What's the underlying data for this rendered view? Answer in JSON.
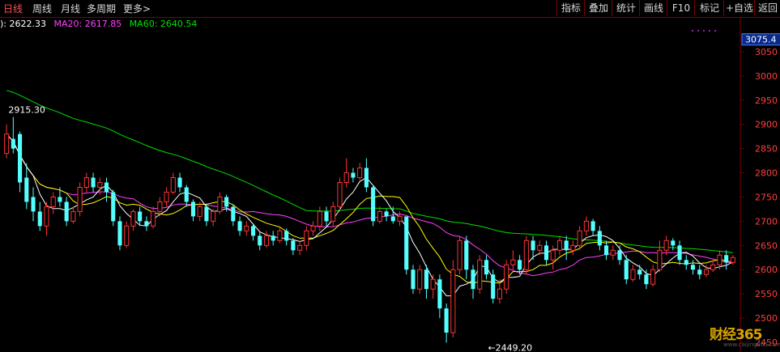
{
  "toolbar": {
    "left_tabs": [
      "日线",
      "周线",
      "月线",
      "多周期",
      "更多>"
    ],
    "right_buttons": [
      "指标",
      "叠加",
      "统计",
      "画线",
      "F10",
      "标记",
      "+自选",
      "返回"
    ]
  },
  "ma_legend": {
    "ma5": "): 2622.33",
    "ma20": "MA20: 2617.85",
    "ma60": "MA60: 2640.54"
  },
  "colors": {
    "up": "#ff3232",
    "down": "#54ffff",
    "ma5": "#ffffff",
    "ma10": "#ffff00",
    "ma20": "#ff40ff",
    "ma60": "#00e000",
    "grid": "#7a0000",
    "axis_text": "#ff4040"
  },
  "watermark": {
    "brand": "财经365",
    "url": "www.caijing365.com"
  },
  "chart_data": {
    "type": "candlestick",
    "ylim": [
      2430,
      3120
    ],
    "y_ticks": [
      2450,
      2500,
      2550,
      2600,
      2650,
      2700,
      2750,
      2800,
      2850,
      2900,
      2950,
      3000,
      3050
    ],
    "current_price_label": "3075.4",
    "current_price_value": 3075.4,
    "annotations": [
      {
        "text": "2915.30",
        "index": 1,
        "value": 2915.3
      },
      {
        "text": "←2449.20",
        "index": 72,
        "value": 2449.2
      }
    ],
    "candles": [
      [
        2840,
        2880,
        2900,
        2830
      ],
      [
        2870,
        2850,
        2915.3,
        2840
      ],
      [
        2880,
        2780,
        2885,
        2760
      ],
      [
        2790,
        2740,
        2820,
        2725
      ],
      [
        2750,
        2720,
        2770,
        2700
      ],
      [
        2720,
        2690,
        2740,
        2680
      ],
      [
        2690,
        2730,
        2740,
        2670
      ],
      [
        2730,
        2750,
        2760,
        2715
      ],
      [
        2750,
        2740,
        2770,
        2730
      ],
      [
        2740,
        2700,
        2750,
        2690
      ],
      [
        2700,
        2720,
        2730,
        2695
      ],
      [
        2720,
        2770,
        2780,
        2710
      ],
      [
        2770,
        2790,
        2800,
        2760
      ],
      [
        2790,
        2770,
        2800,
        2760
      ],
      [
        2770,
        2780,
        2790,
        2755
      ],
      [
        2780,
        2760,
        2790,
        2740
      ],
      [
        2760,
        2700,
        2765,
        2690
      ],
      [
        2700,
        2650,
        2710,
        2640
      ],
      [
        2650,
        2690,
        2700,
        2645
      ],
      [
        2690,
        2720,
        2725,
        2680
      ],
      [
        2720,
        2700,
        2730,
        2690
      ],
      [
        2700,
        2690,
        2710,
        2680
      ],
      [
        2690,
        2720,
        2730,
        2685
      ],
      [
        2720,
        2740,
        2750,
        2710
      ],
      [
        2740,
        2760,
        2770,
        2730
      ],
      [
        2760,
        2790,
        2800,
        2755
      ],
      [
        2790,
        2770,
        2800,
        2760
      ],
      [
        2770,
        2740,
        2775,
        2730
      ],
      [
        2740,
        2710,
        2745,
        2700
      ],
      [
        2710,
        2730,
        2740,
        2700
      ],
      [
        2730,
        2700,
        2735,
        2690
      ],
      [
        2700,
        2720,
        2725,
        2690
      ],
      [
        2720,
        2750,
        2760,
        2715
      ],
      [
        2750,
        2730,
        2755,
        2720
      ],
      [
        2730,
        2700,
        2735,
        2690
      ],
      [
        2700,
        2680,
        2710,
        2670
      ],
      [
        2680,
        2690,
        2700,
        2670
      ],
      [
        2690,
        2670,
        2695,
        2660
      ],
      [
        2670,
        2650,
        2680,
        2640
      ],
      [
        2650,
        2670,
        2680,
        2645
      ],
      [
        2670,
        2660,
        2680,
        2650
      ],
      [
        2660,
        2680,
        2690,
        2655
      ],
      [
        2680,
        2660,
        2685,
        2650
      ],
      [
        2660,
        2640,
        2665,
        2630
      ],
      [
        2640,
        2650,
        2660,
        2630
      ],
      [
        2650,
        2680,
        2690,
        2640
      ],
      [
        2680,
        2690,
        2700,
        2670
      ],
      [
        2690,
        2720,
        2730,
        2680
      ],
      [
        2720,
        2700,
        2730,
        2690
      ],
      [
        2700,
        2730,
        2740,
        2690
      ],
      [
        2730,
        2780,
        2790,
        2720
      ],
      [
        2780,
        2800,
        2830,
        2770
      ],
      [
        2800,
        2790,
        2810,
        2780
      ],
      [
        2790,
        2810,
        2820,
        2785
      ],
      [
        2810,
        2770,
        2830,
        2760
      ],
      [
        2770,
        2700,
        2775,
        2690
      ],
      [
        2700,
        2720,
        2730,
        2695
      ],
      [
        2720,
        2710,
        2725,
        2700
      ],
      [
        2710,
        2700,
        2730,
        2695
      ],
      [
        2700,
        2710,
        2720,
        2690
      ],
      [
        2710,
        2600,
        2710,
        2590
      ],
      [
        2600,
        2560,
        2610,
        2550
      ],
      [
        2560,
        2600,
        2610,
        2550
      ],
      [
        2600,
        2560,
        2610,
        2540
      ],
      [
        2560,
        2580,
        2590,
        2540
      ],
      [
        2580,
        2520,
        2590,
        2500
      ],
      [
        2520,
        2470,
        2530,
        2449.2
      ],
      [
        2470,
        2600,
        2620,
        2460
      ],
      [
        2600,
        2660,
        2670,
        2590
      ],
      [
        2660,
        2600,
        2670,
        2580
      ],
      [
        2600,
        2560,
        2610,
        2540
      ],
      [
        2560,
        2620,
        2630,
        2550
      ],
      [
        2620,
        2590,
        2630,
        2580
      ],
      [
        2590,
        2540,
        2600,
        2530
      ],
      [
        2540,
        2560,
        2580,
        2530
      ],
      [
        2560,
        2610,
        2620,
        2550
      ],
      [
        2610,
        2620,
        2640,
        2600
      ],
      [
        2620,
        2600,
        2630,
        2590
      ],
      [
        2600,
        2660,
        2670,
        2590
      ],
      [
        2660,
        2640,
        2670,
        2620
      ],
      [
        2640,
        2650,
        2660,
        2630
      ],
      [
        2650,
        2620,
        2660,
        2610
      ],
      [
        2620,
        2640,
        2650,
        2600
      ],
      [
        2640,
        2660,
        2670,
        2630
      ],
      [
        2660,
        2640,
        2670,
        2620
      ],
      [
        2640,
        2650,
        2660,
        2630
      ],
      [
        2650,
        2680,
        2690,
        2640
      ],
      [
        2680,
        2700,
        2710,
        2670
      ],
      [
        2700,
        2680,
        2705,
        2670
      ],
      [
        2680,
        2650,
        2690,
        2640
      ],
      [
        2650,
        2630,
        2660,
        2620
      ],
      [
        2630,
        2640,
        2650,
        2620
      ],
      [
        2640,
        2620,
        2650,
        2610
      ],
      [
        2620,
        2580,
        2630,
        2570
      ],
      [
        2580,
        2600,
        2610,
        2575
      ],
      [
        2600,
        2590,
        2610,
        2580
      ],
      [
        2590,
        2570,
        2600,
        2560
      ],
      [
        2570,
        2600,
        2610,
        2565
      ],
      [
        2600,
        2640,
        2660,
        2595
      ],
      [
        2640,
        2660,
        2670,
        2630
      ],
      [
        2660,
        2650,
        2665,
        2640
      ],
      [
        2650,
        2620,
        2660,
        2610
      ],
      [
        2620,
        2610,
        2630,
        2600
      ],
      [
        2610,
        2600,
        2620,
        2590
      ],
      [
        2600,
        2590,
        2610,
        2580
      ],
      [
        2590,
        2600,
        2610,
        2585
      ],
      [
        2600,
        2610,
        2620,
        2595
      ],
      [
        2610,
        2630,
        2640,
        2600
      ],
      [
        2630,
        2615,
        2640,
        2600
      ],
      [
        2615,
        2625,
        2630,
        2610
      ]
    ]
  }
}
